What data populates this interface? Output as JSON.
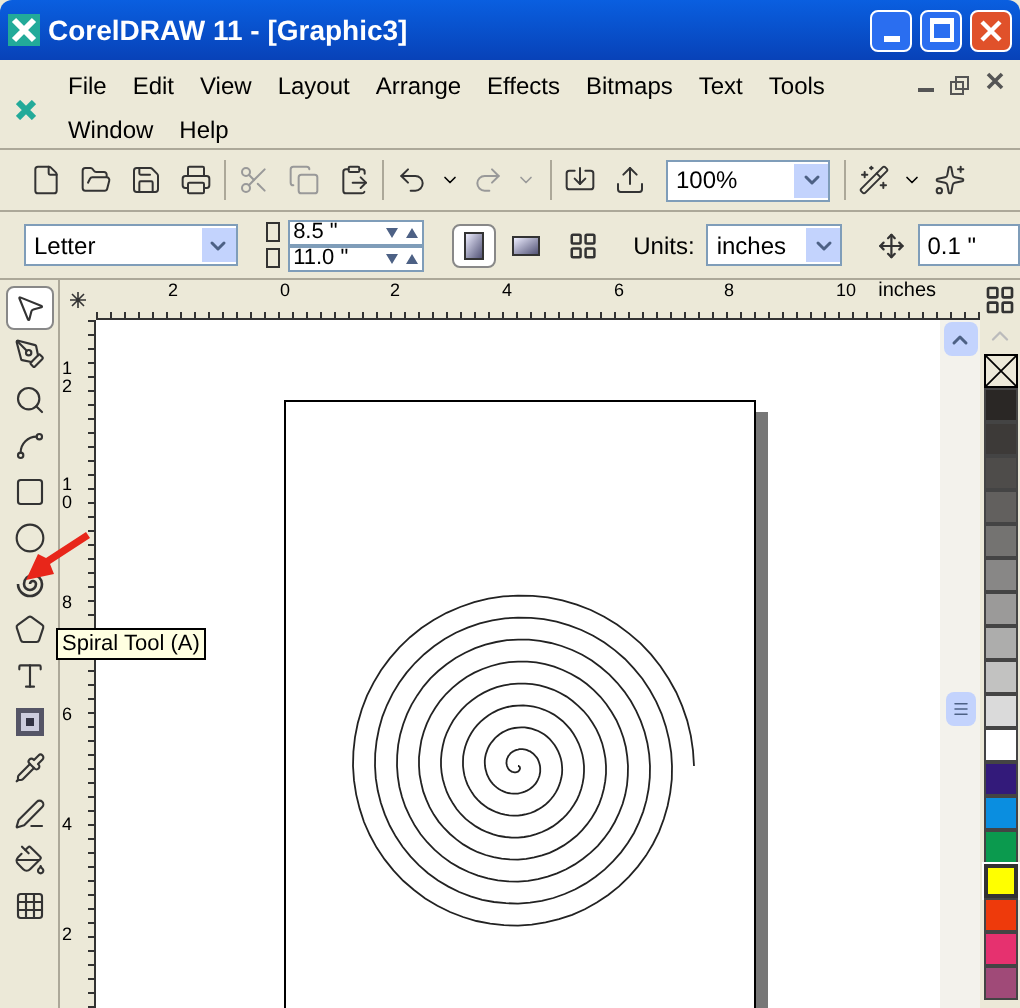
{
  "window": {
    "title": "CorelDRAW 11 - [Graphic3]"
  },
  "menu": [
    {
      "label": "File"
    },
    {
      "label": "Edit"
    },
    {
      "label": "View"
    },
    {
      "label": "Layout"
    },
    {
      "label": "Arrange"
    },
    {
      "label": "Effects"
    },
    {
      "label": "Bitmaps"
    },
    {
      "label": "Text"
    },
    {
      "label": "Tools"
    },
    {
      "label": "Window"
    },
    {
      "label": "Help"
    }
  ],
  "toolbar": {
    "zoom": "100%"
  },
  "property_bar": {
    "paper": "Letter",
    "width": "8.5 \"",
    "height": "11.0 \"",
    "orientation": [
      {
        "kind": "portrait",
        "selected": true
      },
      {
        "kind": "landscape",
        "selected": false
      }
    ],
    "units_label": "Units:",
    "units": "inches",
    "nudge": "0.1 \""
  },
  "rulers": {
    "horizontal": [
      "2",
      "0",
      "2",
      "4",
      "6",
      "8",
      "10"
    ],
    "unit": "inches",
    "vertical": [
      "12",
      "10",
      "8",
      "6",
      "4",
      "2"
    ]
  },
  "toolbox": [
    {
      "kind": "pick",
      "selected": true
    },
    {
      "kind": "shape",
      "selected": false
    },
    {
      "kind": "zoom",
      "selected": false
    },
    {
      "kind": "freehand",
      "selected": false
    },
    {
      "kind": "rectangle",
      "selected": false
    },
    {
      "kind": "ellipse",
      "selected": false
    },
    {
      "kind": "spiral",
      "selected": false
    },
    {
      "kind": "polygon",
      "selected": false
    },
    {
      "kind": "text",
      "selected": false
    },
    {
      "kind": "interactive",
      "selected": false
    },
    {
      "kind": "eyedropper",
      "selected": false
    },
    {
      "kind": "outline",
      "selected": false
    },
    {
      "kind": "fill",
      "selected": false
    },
    {
      "kind": "grid",
      "selected": false
    }
  ],
  "tooltip": "Spiral Tool (A)",
  "palette": [
    {
      "kind": "none",
      "selected": false
    },
    {
      "color": "#2a2725",
      "selected": false
    },
    {
      "color": "#3d3a38",
      "selected": false
    },
    {
      "color": "#4e4c4a",
      "selected": false
    },
    {
      "color": "#62605e",
      "selected": false
    },
    {
      "color": "#747371",
      "selected": false
    },
    {
      "color": "#888786",
      "selected": false
    },
    {
      "color": "#9b9a99",
      "selected": false
    },
    {
      "color": "#adadac",
      "selected": false
    },
    {
      "color": "#c2c2c1",
      "selected": false
    },
    {
      "color": "#dadada",
      "selected": false
    },
    {
      "color": "#ffffff",
      "selected": false
    },
    {
      "color": "#331a7a",
      "selected": false
    },
    {
      "color": "#0a8ee0",
      "selected": false
    },
    {
      "color": "#0b9a4e",
      "selected": false
    },
    {
      "color": "#ffff00",
      "selected": true
    },
    {
      "color": "#ee3a0b",
      "selected": false
    },
    {
      "color": "#e6316f",
      "selected": false
    },
    {
      "color": "#a04a78",
      "selected": false
    }
  ]
}
